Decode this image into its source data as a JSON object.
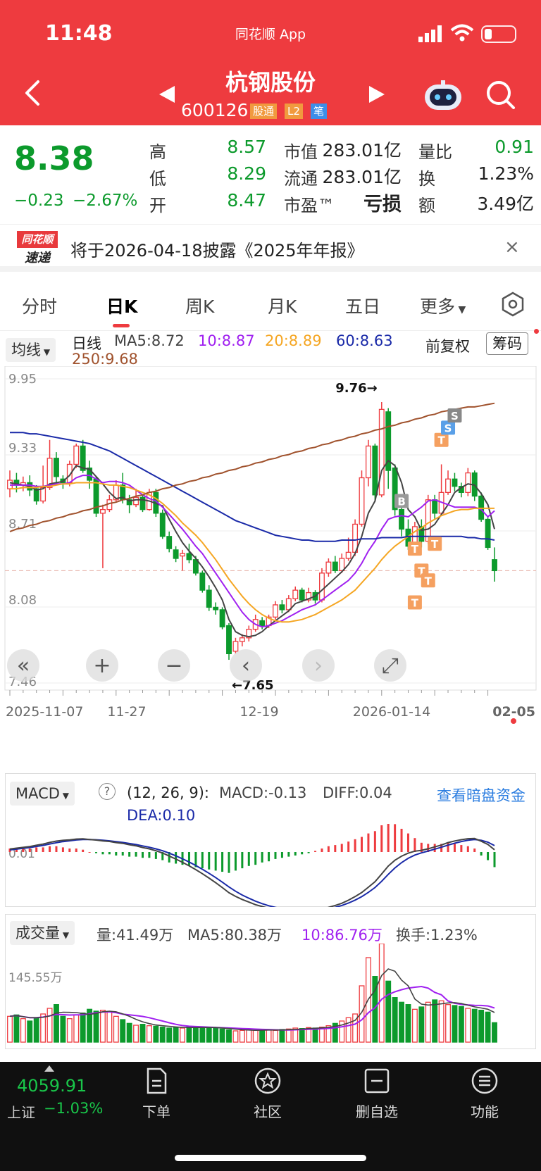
{
  "status_bar": {
    "time": "11:48",
    "app_label": "同花顺 App"
  },
  "header": {
    "title": "杭钢股份",
    "code": "600126",
    "tags": [
      "股通",
      "L2",
      "笔"
    ]
  },
  "quote": {
    "price": "8.38",
    "change": "−0.23",
    "change_pct": "−2.67%",
    "high_label": "高",
    "high": "8.57",
    "low_label": "低",
    "low": "8.29",
    "open_label": "开",
    "open": "8.47",
    "mktcap_label": "市值",
    "mktcap": "283.01亿",
    "float_label": "流通",
    "float_cap": "283.01亿",
    "pe_label": "市盈™",
    "pe": "亏损",
    "vol_ratio_label": "量比",
    "vol_ratio": "0.91",
    "turnover_label": "换",
    "turnover": "1.23%",
    "amount_label": "额",
    "amount": "3.49亿"
  },
  "notice": {
    "logo_top": "同花顺",
    "logo_bottom": "速递",
    "text": "将于2026-04-18披露《2025年年报》",
    "close": "×"
  },
  "tabs": [
    "分时",
    "日K",
    "周K",
    "月K",
    "五日",
    "更多"
  ],
  "active_tab": 1,
  "ma_bar": {
    "selector": "均线",
    "period": "日线",
    "ma5": "MA5:8.72",
    "ma10": "10:8.87",
    "ma20": "20:8.89",
    "ma60": "60:8.63",
    "ma250": "250:9.68",
    "adjust": "前复权",
    "chips": "筹码"
  },
  "kline": {
    "y_ticks": [
      "9.95",
      "9.33",
      "8.71",
      "8.08",
      "7.46"
    ],
    "high_mark": "9.76→",
    "low_mark": "←7.65",
    "dates": [
      "2025-11-07",
      "11-27",
      "12-19",
      "2026-01-14",
      "02-05"
    ]
  },
  "macd": {
    "selector": "MACD",
    "params": "(12, 26, 9):",
    "macd": "MACD:-0.13",
    "diff": "DIFF:0.04",
    "dea": "DEA:0.10",
    "link": "查看暗盘资金",
    "y_label": "0.01"
  },
  "volume": {
    "selector": "成交量",
    "vol": "量:41.49万",
    "ma5": "MA5:80.38万",
    "ma10": "10:86.76万",
    "turnover": "换手:1.23%",
    "y_label": "145.55万"
  },
  "bottom_bar": {
    "index_value": "4059.91",
    "index_name": "上证",
    "index_change": "−1.03%",
    "items": [
      "下单",
      "社区",
      "删自选",
      "功能"
    ]
  },
  "colors": {
    "red": "#ee3b3f",
    "green": "#0c9a2c",
    "ma5": "#444444",
    "ma10": "#a020f0",
    "ma20": "#f5a623",
    "ma60": "#1a2aa8",
    "ma250": "#a0522d"
  },
  "chart_data": {
    "type": "candlestick",
    "series": [
      {
        "name": "日线",
        "values": [
          [
            9.05,
            9.12,
            9.2,
            8.98
          ],
          [
            9.12,
            9.08,
            9.18,
            9.02
          ],
          [
            9.08,
            9.1,
            9.15,
            9.03
          ],
          [
            9.1,
            9.04,
            9.16,
            8.99
          ],
          [
            9.05,
            8.95,
            9.08,
            8.92
          ],
          [
            8.95,
            9.06,
            9.24,
            8.93
          ],
          [
            9.06,
            9.3,
            9.45,
            9.04
          ],
          [
            9.3,
            9.15,
            9.35,
            9.08
          ],
          [
            9.13,
            9.1,
            9.16,
            9.05
          ],
          [
            9.1,
            9.25,
            9.28,
            9.07
          ],
          [
            9.25,
            9.4,
            9.42,
            9.22
          ],
          [
            9.4,
            9.2,
            9.45,
            9.18
          ],
          [
            9.22,
            9.12,
            9.28,
            9.05
          ],
          [
            9.13,
            8.85,
            9.15,
            8.82
          ],
          [
            8.85,
            8.88,
            8.92,
            8.4
          ],
          [
            8.88,
            8.96,
            9.0,
            8.86
          ],
          [
            8.96,
            9.08,
            9.12,
            8.94
          ],
          [
            9.08,
            8.96,
            9.18,
            8.93
          ],
          [
            8.96,
            8.92,
            9.0,
            8.85
          ],
          [
            8.92,
            8.98,
            9.05,
            8.9
          ],
          [
            8.98,
            8.88,
            9.0,
            8.86
          ],
          [
            8.88,
            9.02,
            9.05,
            8.87
          ],
          [
            9.02,
            8.85,
            9.05,
            8.82
          ],
          [
            8.85,
            8.66,
            8.88,
            8.64
          ],
          [
            8.66,
            8.56,
            8.7,
            8.53
          ],
          [
            8.55,
            8.48,
            8.58,
            8.45
          ],
          [
            8.5,
            8.52,
            8.55,
            8.38
          ],
          [
            8.52,
            8.47,
            8.6,
            8.44
          ],
          [
            8.47,
            8.36,
            8.5,
            8.34
          ],
          [
            8.36,
            8.22,
            8.38,
            8.2
          ],
          [
            8.22,
            8.08,
            8.26,
            8.05
          ],
          [
            8.08,
            8.06,
            8.12,
            8.02
          ],
          [
            8.06,
            7.92,
            8.08,
            7.9
          ],
          [
            7.93,
            7.7,
            7.95,
            7.65
          ],
          [
            7.72,
            7.8,
            7.83,
            7.7
          ],
          [
            7.8,
            7.83,
            7.86,
            7.76
          ],
          [
            7.83,
            7.9,
            7.93,
            7.8
          ],
          [
            7.9,
            7.98,
            8.02,
            7.88
          ],
          [
            7.97,
            7.93,
            8.0,
            7.9
          ],
          [
            7.93,
            8.0,
            8.02,
            7.91
          ],
          [
            8.0,
            8.1,
            8.13,
            7.98
          ],
          [
            8.1,
            8.06,
            8.14,
            8.03
          ],
          [
            8.06,
            8.15,
            8.18,
            8.04
          ],
          [
            8.15,
            8.22,
            8.25,
            8.13
          ],
          [
            8.22,
            8.14,
            8.24,
            8.12
          ],
          [
            8.14,
            8.2,
            8.24,
            8.12
          ],
          [
            8.2,
            8.14,
            8.22,
            8.11
          ],
          [
            8.14,
            8.36,
            8.4,
            8.12
          ],
          [
            8.36,
            8.45,
            8.48,
            8.33
          ],
          [
            8.45,
            8.38,
            8.5,
            8.36
          ],
          [
            8.38,
            8.48,
            8.52,
            8.36
          ],
          [
            8.48,
            8.53,
            8.65,
            8.46
          ],
          [
            8.53,
            8.76,
            8.8,
            8.5
          ],
          [
            8.76,
            9.14,
            9.2,
            8.74
          ],
          [
            9.14,
            9.4,
            9.45,
            9.07
          ],
          [
            9.4,
            9.0,
            9.42,
            8.95
          ],
          [
            9.0,
            9.7,
            9.76,
            8.98
          ],
          [
            9.68,
            9.2,
            9.71,
            9.05
          ],
          [
            9.22,
            8.88,
            9.25,
            8.83
          ],
          [
            8.88,
            8.72,
            8.92,
            8.66
          ],
          [
            8.72,
            8.58,
            8.8,
            8.55
          ],
          [
            8.58,
            8.74,
            8.78,
            8.55
          ],
          [
            8.74,
            8.62,
            8.8,
            8.57
          ],
          [
            8.62,
            8.96,
            9.0,
            8.6
          ],
          [
            8.96,
            8.85,
            9.0,
            8.8
          ],
          [
            8.85,
            9.02,
            9.25,
            8.84
          ],
          [
            9.02,
            9.13,
            9.2,
            9.0
          ],
          [
            9.13,
            9.07,
            9.18,
            9.03
          ],
          [
            9.07,
            9.02,
            9.1,
            8.98
          ],
          [
            9.02,
            9.18,
            9.22,
            8.99
          ],
          [
            9.18,
            8.99,
            9.2,
            8.95
          ],
          [
            8.99,
            8.8,
            9.02,
            8.78
          ],
          [
            8.8,
            8.57,
            8.82,
            8.55
          ],
          [
            8.47,
            8.38,
            8.57,
            8.29
          ]
        ]
      },
      {
        "name": "MA5",
        "values": [
          9.1,
          9.09,
          9.08,
          9.07,
          9.04,
          9.05,
          9.09,
          9.1,
          9.11,
          9.16,
          9.24,
          9.22,
          9.21,
          9.15,
          9.09,
          9.02,
          8.97,
          8.98,
          8.95,
          8.96,
          8.96,
          8.95,
          8.93,
          8.91,
          8.8,
          8.7,
          8.61,
          8.54,
          8.48,
          8.41,
          8.33,
          8.24,
          8.14,
          7.98,
          7.88,
          7.85,
          7.84,
          7.85,
          7.88,
          7.93,
          7.97,
          8.01,
          8.05,
          8.11,
          8.13,
          8.15,
          8.17,
          8.22,
          8.27,
          8.32,
          8.37,
          8.43,
          8.52,
          8.66,
          8.85,
          8.95,
          9.2,
          9.28,
          9.24,
          9.1,
          8.88,
          8.82,
          8.71,
          8.72,
          8.76,
          8.84,
          8.92,
          9.02,
          9.06,
          9.09,
          9.08,
          9.01,
          8.92,
          8.72
        ]
      },
      {
        "name": "MA10",
        "values": [
          9.08,
          9.08,
          9.08,
          9.08,
          9.07,
          9.07,
          9.08,
          9.09,
          9.09,
          9.1,
          9.14,
          9.16,
          9.16,
          9.13,
          9.1,
          9.11,
          9.11,
          9.1,
          9.08,
          9.04,
          9.0,
          8.97,
          8.95,
          8.9,
          8.84,
          8.78,
          8.72,
          8.65,
          8.58,
          8.52,
          8.44,
          8.36,
          8.28,
          8.2,
          8.12,
          8.04,
          7.98,
          7.94,
          7.92,
          7.93,
          7.95,
          7.97,
          8.0,
          8.03,
          8.06,
          8.08,
          8.1,
          8.14,
          8.18,
          8.22,
          8.26,
          8.3,
          8.36,
          8.44,
          8.54,
          8.62,
          8.72,
          8.8,
          8.82,
          8.83,
          8.82,
          8.86,
          8.9,
          8.95,
          8.96,
          8.94,
          8.92,
          8.9,
          8.9,
          8.9,
          8.9,
          8.88,
          8.82,
          8.87
        ]
      },
      {
        "name": "MA20",
        "values": [
          9.05,
          9.05,
          9.06,
          9.06,
          9.06,
          9.07,
          9.07,
          9.08,
          9.09,
          9.09,
          9.1,
          9.1,
          9.1,
          9.1,
          9.09,
          9.08,
          9.08,
          9.07,
          9.06,
          9.04,
          9.02,
          9.0,
          8.97,
          8.93,
          8.88,
          8.83,
          8.77,
          8.72,
          8.67,
          8.61,
          8.54,
          8.47,
          8.39,
          8.31,
          8.24,
          8.17,
          8.11,
          8.06,
          8.02,
          7.99,
          7.97,
          7.96,
          7.96,
          7.97,
          7.98,
          8.0,
          8.02,
          8.05,
          8.08,
          8.11,
          8.14,
          8.18,
          8.22,
          8.28,
          8.34,
          8.4,
          8.47,
          8.53,
          8.58,
          8.62,
          8.66,
          8.7,
          8.73,
          8.77,
          8.8,
          8.83,
          8.85,
          8.87,
          8.88,
          8.88,
          8.89,
          8.89,
          8.89,
          8.89
        ]
      },
      {
        "name": "MA60",
        "values": [
          9.51,
          9.51,
          9.51,
          9.5,
          9.5,
          9.49,
          9.48,
          9.47,
          9.46,
          9.45,
          9.44,
          9.43,
          9.42,
          9.4,
          9.38,
          9.36,
          9.33,
          9.3,
          9.27,
          9.24,
          9.21,
          9.18,
          9.15,
          9.12,
          9.09,
          9.06,
          9.03,
          9.0,
          8.97,
          8.94,
          8.91,
          8.88,
          8.85,
          8.82,
          8.79,
          8.77,
          8.75,
          8.73,
          8.71,
          8.69,
          8.67,
          8.66,
          8.65,
          8.64,
          8.63,
          8.63,
          8.62,
          8.62,
          8.62,
          8.62,
          8.63,
          8.63,
          8.63,
          8.64,
          8.64,
          8.64,
          8.65,
          8.65,
          8.65,
          8.65,
          8.66,
          8.66,
          8.66,
          8.66,
          8.66,
          8.66,
          8.66,
          8.66,
          8.66,
          8.65,
          8.65,
          8.64,
          8.64,
          8.63
        ]
      },
      {
        "name": "MA250",
        "values": [
          8.7,
          8.72,
          8.73,
          8.75,
          8.76,
          8.78,
          8.79,
          8.81,
          8.82,
          8.84,
          8.85,
          8.87,
          8.88,
          8.9,
          8.91,
          8.93,
          8.94,
          8.96,
          8.97,
          8.99,
          9.0,
          9.02,
          9.03,
          9.05,
          9.06,
          9.08,
          9.09,
          9.11,
          9.12,
          9.14,
          9.15,
          9.17,
          9.18,
          9.2,
          9.21,
          9.23,
          9.24,
          9.26,
          9.27,
          9.29,
          9.3,
          9.32,
          9.33,
          9.35,
          9.36,
          9.38,
          9.39,
          9.41,
          9.42,
          9.44,
          9.45,
          9.47,
          9.48,
          9.5,
          9.51,
          9.53,
          9.54,
          9.56,
          9.57,
          9.59,
          9.6,
          9.62,
          9.63,
          9.65,
          9.66,
          9.68,
          9.69,
          9.7,
          9.71,
          9.72,
          9.72,
          9.73,
          9.74,
          9.75
        ]
      }
    ],
    "ylim": [
      7.46,
      9.95
    ],
    "macd_hist": [
      0.03,
      0.03,
      0.03,
      0.03,
      0.04,
      0.04,
      0.05,
      0.05,
      0.04,
      0.03,
      0.03,
      0.02,
      0.0,
      -0.01,
      -0.02,
      -0.02,
      -0.03,
      -0.03,
      -0.04,
      -0.04,
      -0.05,
      -0.05,
      -0.06,
      -0.07,
      -0.09,
      -0.1,
      -0.11,
      -0.12,
      -0.13,
      -0.14,
      -0.15,
      -0.16,
      -0.17,
      -0.18,
      -0.16,
      -0.14,
      -0.12,
      -0.11,
      -0.09,
      -0.08,
      -0.06,
      -0.05,
      -0.04,
      -0.03,
      -0.02,
      -0.01,
      0.01,
      0.03,
      0.05,
      0.06,
      0.07,
      0.09,
      0.11,
      0.13,
      0.16,
      0.18,
      0.23,
      0.26,
      0.24,
      0.2,
      0.16,
      0.12,
      0.08,
      0.07,
      0.07,
      0.07,
      0.08,
      0.07,
      0.06,
      0.05,
      0.03,
      -0.03,
      -0.07,
      -0.13
    ],
    "volume": [
      55,
      58,
      50,
      45,
      52,
      60,
      72,
      80,
      55,
      50,
      58,
      62,
      70,
      66,
      68,
      64,
      55,
      48,
      40,
      36,
      38,
      35,
      34,
      32,
      30,
      31,
      30,
      33,
      32,
      30,
      31,
      30,
      28,
      26,
      24,
      25,
      26,
      25,
      27,
      26,
      25,
      27,
      28,
      30,
      29,
      31,
      30,
      32,
      35,
      40,
      45,
      52,
      60,
      120,
      180,
      140,
      210,
      130,
      95,
      85,
      80,
      70,
      75,
      85,
      90,
      88,
      80,
      78,
      76,
      72,
      70,
      68,
      64,
      41.49
    ]
  }
}
